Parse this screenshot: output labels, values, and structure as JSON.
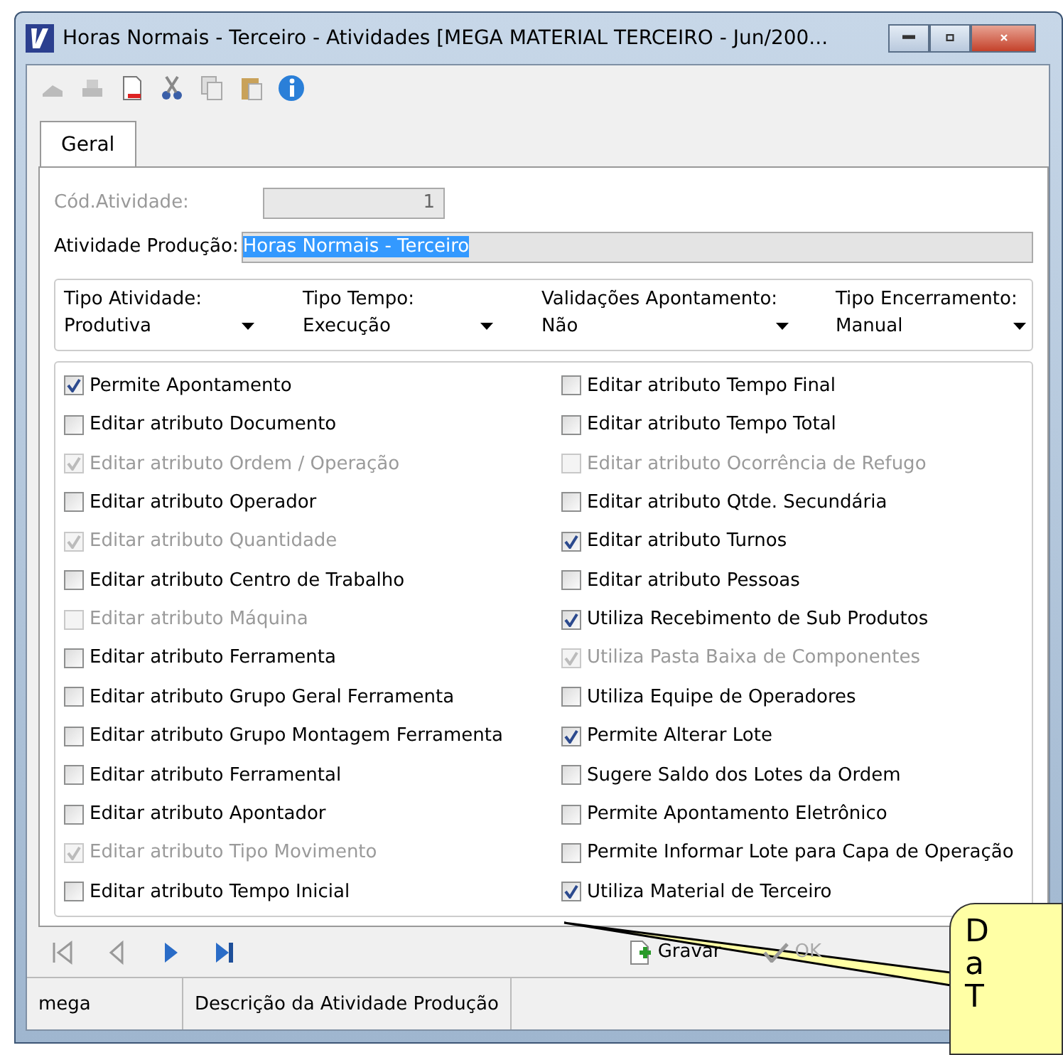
{
  "window": {
    "title": "Horas Normais - Terceiro -  Atividades [MEGA MATERIAL TERCEIRO - Jun/200..."
  },
  "tabs": [
    {
      "label": "Geral",
      "selected": true
    }
  ],
  "fields": [
    {
      "label": "Cód.Atividade:",
      "value": "1",
      "disabled": true,
      "kind": "short"
    },
    {
      "label": "Atividade Produção:",
      "value": "Horas Normais - Terceiro",
      "disabled": false,
      "kind": "long"
    }
  ],
  "dropdowns": [
    {
      "label": "Tipo Atividade:",
      "value": "Produtiva"
    },
    {
      "label": "Tipo Tempo:",
      "value": "Execução"
    },
    {
      "label": "Validações Apontamento:",
      "value": "Não"
    },
    {
      "label": "Tipo Encerramento:",
      "value": "Manual"
    }
  ],
  "checkboxes_left": [
    {
      "label": "Permite Apontamento",
      "checked": true,
      "disabled": false
    },
    {
      "label": "Editar atributo Documento",
      "checked": false,
      "disabled": false
    },
    {
      "label": "Editar atributo Ordem / Operação",
      "checked": true,
      "disabled": true
    },
    {
      "label": "Editar atributo Operador",
      "checked": false,
      "disabled": false
    },
    {
      "label": "Editar atributo Quantidade",
      "checked": true,
      "disabled": true
    },
    {
      "label": "Editar atributo Centro de Trabalho",
      "checked": false,
      "disabled": false
    },
    {
      "label": "Editar atributo Máquina",
      "checked": false,
      "disabled": true
    },
    {
      "label": "Editar atributo Ferramenta",
      "checked": false,
      "disabled": false
    },
    {
      "label": "Editar atributo Grupo Geral Ferramenta",
      "checked": false,
      "disabled": false
    },
    {
      "label": "Editar atributo Grupo Montagem Ferramenta",
      "checked": false,
      "disabled": false
    },
    {
      "label": "Editar atributo Ferramental",
      "checked": false,
      "disabled": false
    },
    {
      "label": "Editar atributo Apontador",
      "checked": false,
      "disabled": false
    },
    {
      "label": "Editar atributo Tipo Movimento",
      "checked": true,
      "disabled": true
    },
    {
      "label": "Editar atributo Tempo Inicial",
      "checked": false,
      "disabled": false
    }
  ],
  "checkboxes_right": [
    {
      "label": "Editar atributo Tempo Final",
      "checked": false,
      "disabled": false
    },
    {
      "label": "Editar atributo Tempo Total",
      "checked": false,
      "disabled": false
    },
    {
      "label": "Editar atributo Ocorrência de Refugo",
      "checked": false,
      "disabled": true
    },
    {
      "label": "Editar atributo Qtde. Secundária",
      "checked": false,
      "disabled": false
    },
    {
      "label": "Editar atributo Turnos",
      "checked": true,
      "disabled": false
    },
    {
      "label": "Editar atributo Pessoas",
      "checked": false,
      "disabled": false
    },
    {
      "label": "Utiliza Recebimento de Sub Produtos",
      "checked": true,
      "disabled": false
    },
    {
      "label": "Utiliza Pasta Baixa de Componentes",
      "checked": true,
      "disabled": true
    },
    {
      "label": "Utiliza Equipe de Operadores",
      "checked": false,
      "disabled": false
    },
    {
      "label": "Permite Alterar Lote",
      "checked": true,
      "disabled": false
    },
    {
      "label": "Sugere Saldo dos Lotes da Ordem",
      "checked": false,
      "disabled": false
    },
    {
      "label": "Permite Apontamento Eletrônico",
      "checked": false,
      "disabled": false
    },
    {
      "label": "Permite Informar Lote para Capa de Operação",
      "checked": false,
      "disabled": false
    },
    {
      "label": "Utiliza Material de Terceiro",
      "checked": true,
      "disabled": false
    }
  ],
  "actions": [
    {
      "label": "Gravar",
      "disabled": false,
      "kind": "save"
    },
    {
      "label": "OK",
      "disabled": true,
      "kind": "ok"
    }
  ],
  "status_bar": [
    "mega",
    "Descrição da Atividade Produção"
  ],
  "callout": {
    "lines": [
      "D",
      "a",
      "T"
    ]
  }
}
